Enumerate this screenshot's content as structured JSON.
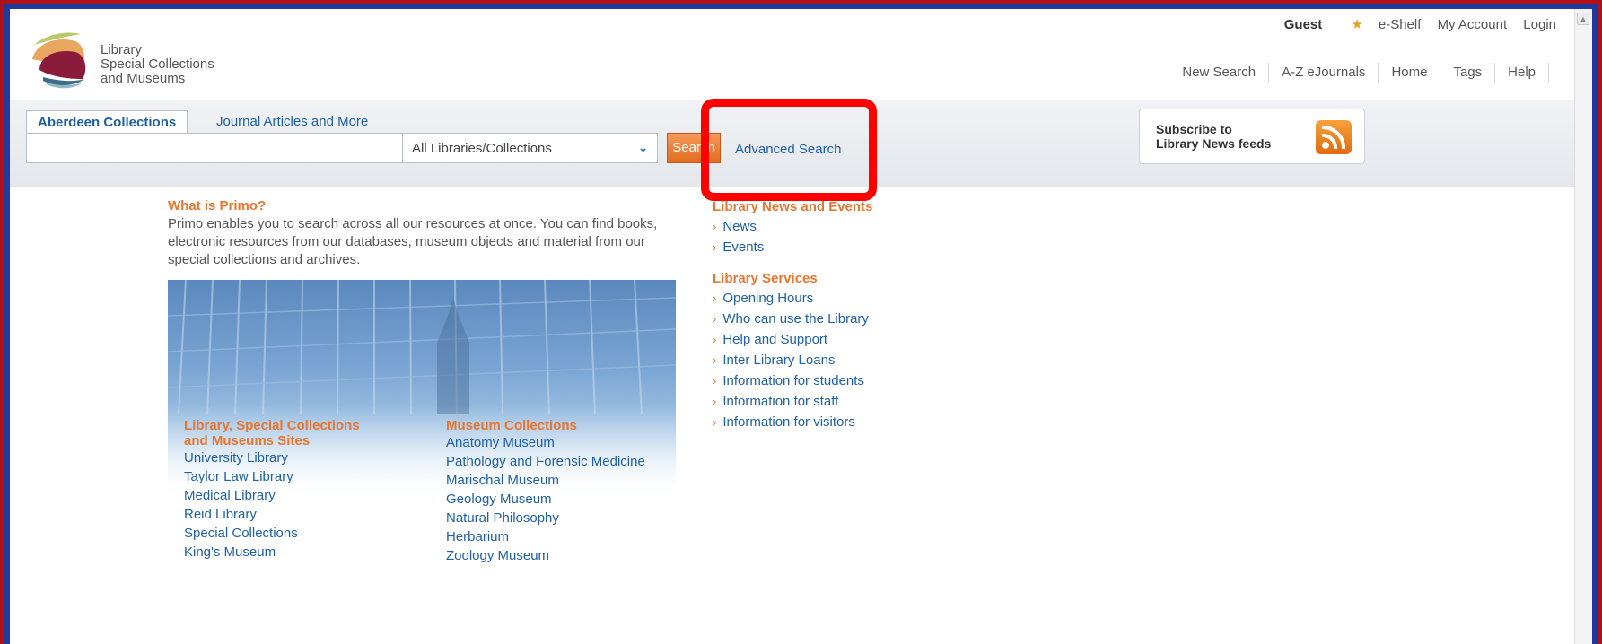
{
  "logo": {
    "lines": [
      "Library",
      "Special Collections",
      "and Museums"
    ]
  },
  "user_bar": {
    "guest": "Guest",
    "eshelf": "e-Shelf",
    "my_account": "My Account",
    "login": "Login"
  },
  "top_nav": {
    "new_search": "New Search",
    "ejournals": "A-Z eJournals",
    "home": "Home",
    "tags": "Tags",
    "help": "Help"
  },
  "search": {
    "tab_active": "Aberdeen Collections",
    "tab_other": "Journal Articles and More",
    "query": "",
    "scope_selected": "All Libraries/Collections",
    "button": "Search",
    "advanced": "Advanced Search"
  },
  "rss": {
    "line1": "Subscribe to",
    "line2": "Library News feeds"
  },
  "intro": {
    "title": "What is Primo?",
    "text": "Primo enables you to search across all our resources at once. You can find books, electronic resources from our databases, museum objects and material from our special collections and archives."
  },
  "sites": {
    "heading_line1": "Library, Special Collections",
    "heading_line2": "and Museums Sites",
    "items": [
      "University Library",
      "Taylor Law Library",
      "Medical Library",
      "Reid Library",
      "Special Collections",
      "King's Museum"
    ]
  },
  "museums": {
    "heading": "Museum Collections",
    "items": [
      "Anatomy Museum",
      "Pathology and Forensic Medicine",
      "Marischal Museum",
      "Geology Museum",
      "Natural Philosophy",
      "Herbarium",
      "Zoology Museum"
    ]
  },
  "news": {
    "heading": "Library News and Events",
    "items": [
      "News",
      "Events"
    ]
  },
  "services": {
    "heading": "Library Services",
    "items": [
      "Opening Hours",
      "Who can use the Library",
      "Help and Support",
      "Inter Library Loans",
      "Information for students",
      "Information for staff",
      "Information for visitors"
    ]
  },
  "colors": {
    "accent_orange": "#e8762e",
    "link_blue": "#1f5fa6",
    "highlight_red": "#ff0000"
  }
}
